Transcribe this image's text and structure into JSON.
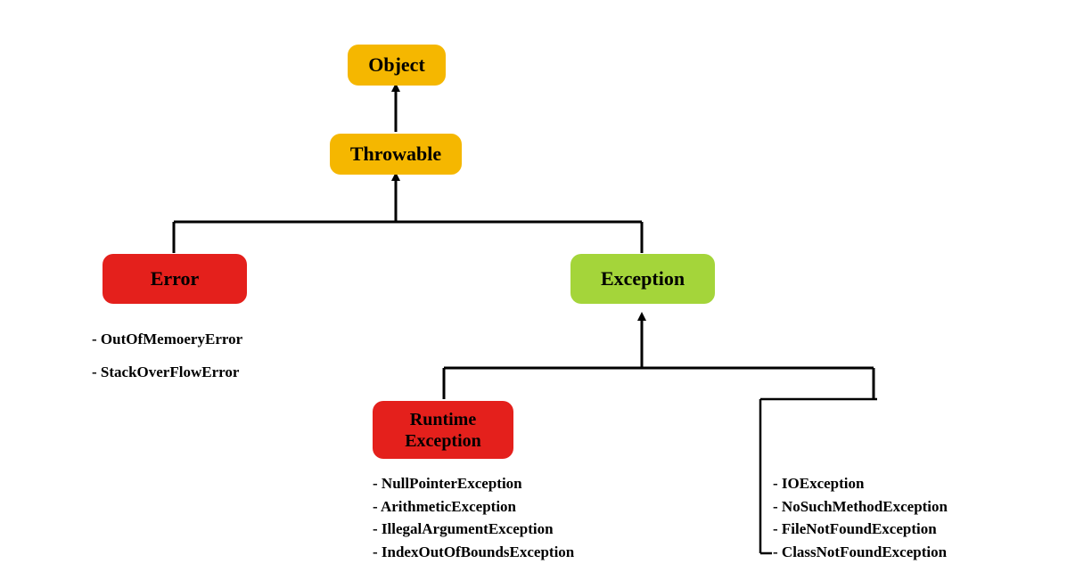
{
  "nodes": {
    "object": "Object",
    "throwable": "Throwable",
    "error": "Error",
    "exception": "Exception",
    "runtime": "Runtime Exception"
  },
  "lists": {
    "error_children": [
      "- OutOfMemoeryError",
      "- StackOverFlowError"
    ],
    "runtime_children": [
      "- NullPointerException",
      "- ArithmeticException",
      "- IllegalArgumentException",
      "- IndexOutOfBoundsException"
    ],
    "exception_children": [
      "- IOException",
      "- NoSuchMethodException",
      "- FileNotFoundException",
      "- ClassNotFoundException"
    ]
  },
  "colors": {
    "orange": "#f5b700",
    "red": "#e4201c",
    "green": "#a4d53a"
  }
}
